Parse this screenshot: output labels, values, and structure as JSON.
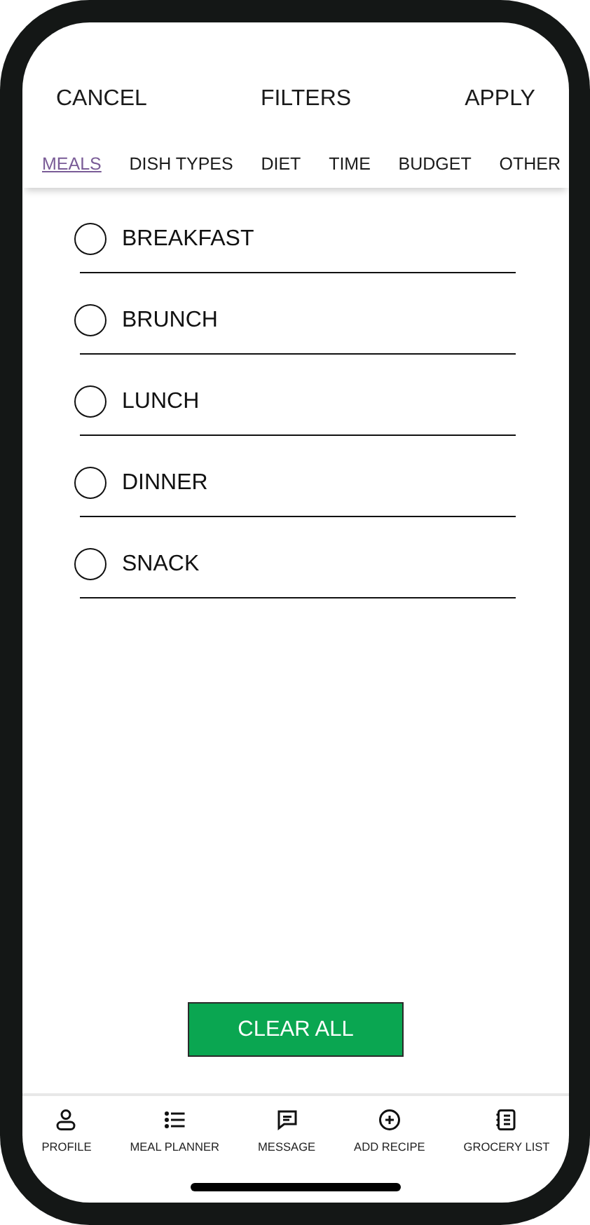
{
  "header": {
    "cancel": "CANCEL",
    "title": "FILTERS",
    "apply": "APPLY"
  },
  "tabs": [
    {
      "label": "MEALS",
      "selected": true
    },
    {
      "label": "DISH TYPES",
      "selected": false
    },
    {
      "label": "DIET",
      "selected": false
    },
    {
      "label": "TIME",
      "selected": false
    },
    {
      "label": "BUDGET",
      "selected": false
    },
    {
      "label": "OTHER",
      "selected": false
    }
  ],
  "options": [
    {
      "label": "BREAKFAST",
      "selected": false
    },
    {
      "label": "BRUNCH",
      "selected": false
    },
    {
      "label": "LUNCH",
      "selected": false
    },
    {
      "label": "DINNER",
      "selected": false
    },
    {
      "label": "SNACK",
      "selected": false
    }
  ],
  "clear_button": "CLEAR ALL",
  "bottom_nav": [
    {
      "label": "PROFILE"
    },
    {
      "label": "MEAL PLANNER"
    },
    {
      "label": "MESSAGE"
    },
    {
      "label": "ADD RECIPE"
    },
    {
      "label": "GROCERY LIST"
    }
  ]
}
